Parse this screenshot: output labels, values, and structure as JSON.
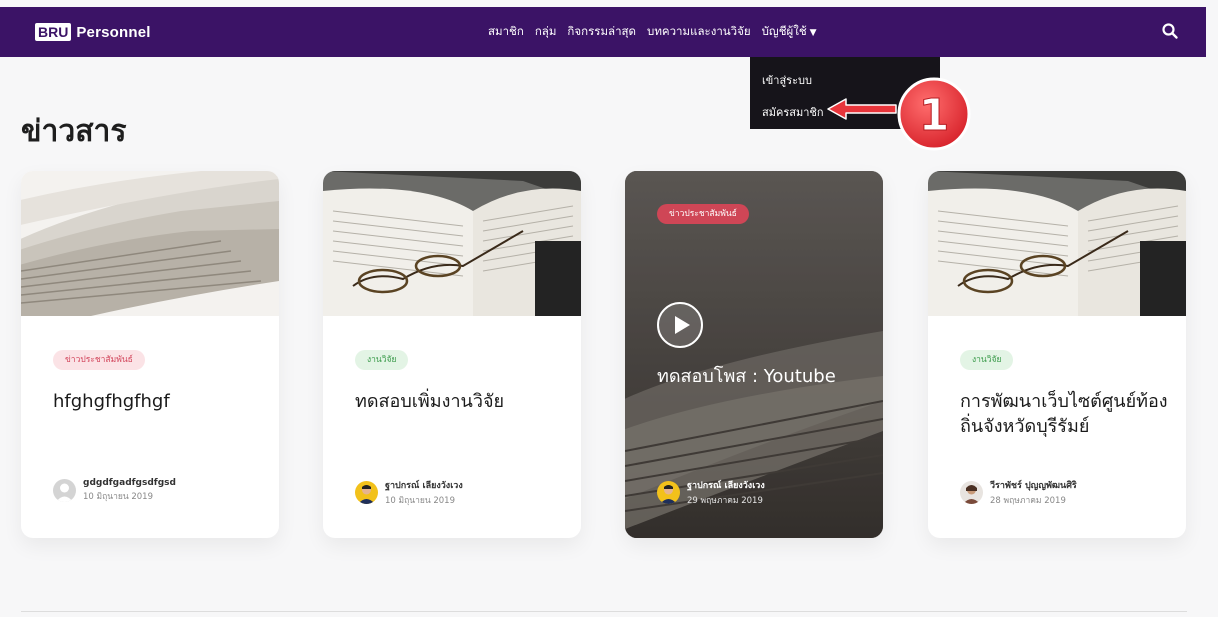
{
  "brand": {
    "badge": "BRU",
    "name": "Personnel"
  },
  "nav": {
    "items": [
      "สมาชิก",
      "กลุ่ม",
      "กิจกรรมล่าสุด",
      "บทความและงานวิจัย"
    ],
    "account": "บัญชีผู้ใช้",
    "search_icon": "search-icon"
  },
  "dropdown": {
    "login": "เข้าสู่ระบบ",
    "register": "สมัครสมาชิก"
  },
  "annotation": {
    "number": "1",
    "color": "#e8353b"
  },
  "page_title": "ข่าวสาร",
  "cards": [
    {
      "category": "ข่าวประชาสัมพันธ์",
      "title": "hfghgfhgfhgf",
      "author": "gdgdfgadfgsdfgsd",
      "date": "10 มิถุนายน 2019"
    },
    {
      "category": "งานวิจัย",
      "title": "ทดสอบเพิ่มงานวิจัย",
      "author": "ฐาปกรณ์ เลียงวังเวง",
      "date": "10 มิถุนายน 2019"
    },
    {
      "category": "ข่าวประชาสัมพันธ์",
      "title": "ทดสอบโพส : Youtube",
      "author": "ฐาปกรณ์ เลียงวังเวง",
      "date": "29 พฤษภาคม 2019"
    },
    {
      "category": "งานวิจัย",
      "title": "การพัฒนาเว็บไซต์ศูนย์ท้องถิ่นจังหวัดบุรีรัมย์",
      "author": "วีราพัชร์ ปุญญพัฒนศิริ",
      "date": "28 พฤษภาคม 2019"
    }
  ],
  "colors": {
    "navbar": "#3b1366",
    "dropdown": "#16141a",
    "badge_pink": "#fbe3e6",
    "badge_green": "#e3f4e5",
    "featured_badge": "#cf4656"
  }
}
